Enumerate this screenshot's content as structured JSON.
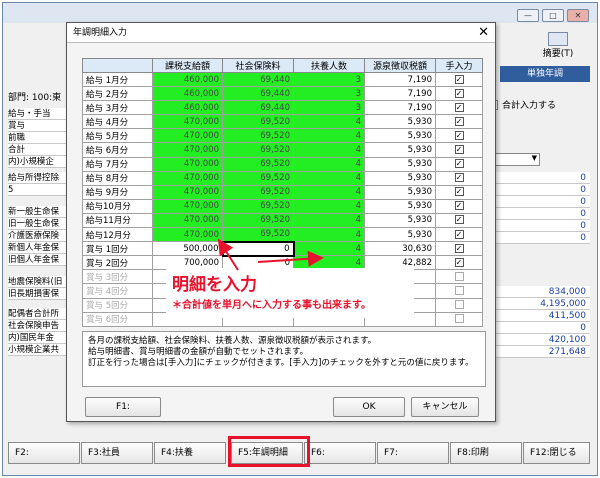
{
  "background": {
    "dept_label": "部門: 100:東",
    "summary_label": "摘要(T)",
    "single_year_label": "単独年調",
    "total_input_label": "合計入力する",
    "left_rows": [
      "給与・手当",
      "賞与",
      "前職",
      "合計",
      "内)小規模企",
      "給与所得控除",
      "5",
      "新一般生命保",
      "旧一般生命保",
      "介護医療保険",
      "新個人年金保",
      "旧個人年金保",
      "地震保険料(旧",
      "旧長期損害保",
      "配偶者合計所",
      "社会保険申告",
      "内)国民年金",
      "小規模企業共"
    ],
    "right_values": [
      "0",
      "0",
      "0",
      "0",
      "0",
      "0",
      "834,000",
      "4,195,000",
      "411,500",
      "0",
      "420,100",
      "271,648"
    ]
  },
  "dialog": {
    "title": "年調明細入力",
    "close_glyph": "✕",
    "columns": [
      "課税支給額",
      "社会保険料",
      "扶養人数",
      "源泉徴収税額",
      "手入力"
    ],
    "rows": [
      {
        "label": "給与 1月分",
        "taxable": "460,000",
        "social": "69,440",
        "dependents": "3",
        "withholding": "7,190",
        "manual": true
      },
      {
        "label": "給与 2月分",
        "taxable": "460,000",
        "social": "69,440",
        "dependents": "3",
        "withholding": "7,190",
        "manual": true
      },
      {
        "label": "給与 3月分",
        "taxable": "460,000",
        "social": "69,440",
        "dependents": "3",
        "withholding": "7,190",
        "manual": true
      },
      {
        "label": "給与 4月分",
        "taxable": "470,000",
        "social": "69,520",
        "dependents": "4",
        "withholding": "5,930",
        "manual": true
      },
      {
        "label": "給与 5月分",
        "taxable": "470,000",
        "social": "69,520",
        "dependents": "4",
        "withholding": "5,930",
        "manual": true
      },
      {
        "label": "給与 6月分",
        "taxable": "470,000",
        "social": "69,520",
        "dependents": "4",
        "withholding": "5,930",
        "manual": true
      },
      {
        "label": "給与 7月分",
        "taxable": "470,000",
        "social": "69,520",
        "dependents": "4",
        "withholding": "5,930",
        "manual": true
      },
      {
        "label": "給与 8月分",
        "taxable": "470,000",
        "social": "69,520",
        "dependents": "4",
        "withholding": "5,930",
        "manual": true
      },
      {
        "label": "給与 9月分",
        "taxable": "470,000",
        "social": "69,520",
        "dependents": "4",
        "withholding": "5,930",
        "manual": true
      },
      {
        "label": "給与10月分",
        "taxable": "470,000",
        "social": "69,520",
        "dependents": "4",
        "withholding": "5,930",
        "manual": true
      },
      {
        "label": "給与11月分",
        "taxable": "470,000",
        "social": "69,520",
        "dependents": "4",
        "withholding": "5,930",
        "manual": true
      },
      {
        "label": "給与12月分",
        "taxable": "470,000",
        "social": "69,520",
        "dependents": "4",
        "withholding": "5,930",
        "manual": true
      },
      {
        "label": "賞与 1回分",
        "taxable": "500,000",
        "social": "0",
        "dependents": "4",
        "withholding": "30,630",
        "manual": true
      },
      {
        "label": "賞与 2回分",
        "taxable": "700,000",
        "social": "0",
        "dependents": "4",
        "withholding": "42,882",
        "manual": true
      },
      {
        "label": "賞与 3回分",
        "taxable": "",
        "social": "",
        "dependents": "",
        "withholding": "",
        "manual": false
      },
      {
        "label": "賞与 4回分",
        "taxable": "",
        "social": "",
        "dependents": "",
        "withholding": "",
        "manual": false
      },
      {
        "label": "賞与 5回分",
        "taxable": "",
        "social": "",
        "dependents": "",
        "withholding": "",
        "manual": false
      },
      {
        "label": "賞与 6回分",
        "taxable": "",
        "social": "",
        "dependents": "",
        "withholding": "",
        "manual": false
      }
    ],
    "notes": [
      "各月の課税支給額、社会保険料、扶養人数、源泉徴収税額が表示されます。",
      "給与明細書、賞与明細書の金額が自動でセットされます。",
      "訂正を行った場合は[手入力]にチェックが付きます。[手入力]のチェックを外すと元の値に戻ります。"
    ],
    "f1_label": "F1:",
    "ok_label": "OK",
    "cancel_label": "キャンセル"
  },
  "annotation": {
    "title": "明細を入力",
    "subtitle": "＊合計値を単月へに入力する事も出来ます。",
    "color": "#e8122c"
  },
  "function_keys": [
    "F2:",
    "F3:社員",
    "F4:扶養",
    "F5:年調明細",
    "F6:",
    "F7:",
    "F8:印刷",
    "F12:閉じる"
  ]
}
